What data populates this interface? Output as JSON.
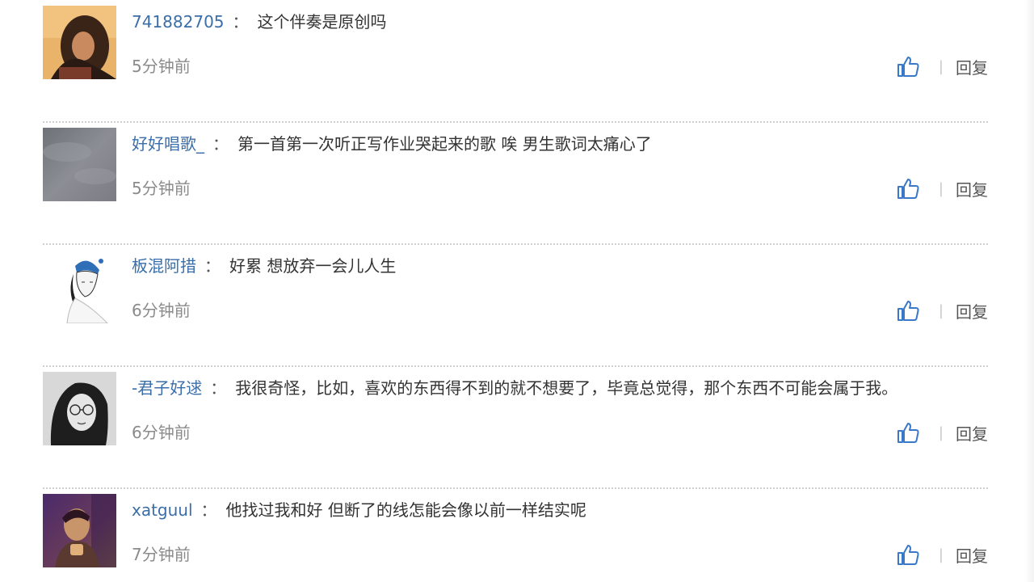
{
  "comments": [
    {
      "username": "741882705",
      "colon": "：",
      "text": "这个伴奏是原创吗",
      "time": "5分钟前",
      "reply_label": "回复",
      "separator": "|"
    },
    {
      "username": "好好唱歌_",
      "colon": "：",
      "text": "第一首第一次听正写作业哭起来的歌 唉 男生歌词太痛心了",
      "time": "5分钟前",
      "reply_label": "回复",
      "separator": "|"
    },
    {
      "username": "板混阿措",
      "colon": "：",
      "text": "好累 想放弃一会儿人生",
      "time": "6分钟前",
      "reply_label": "回复",
      "separator": "|"
    },
    {
      "username": "-君子好逑",
      "colon": "：",
      "text": "我很奇怪，比如，喜欢的东西得不到的就不想要了，毕竟总觉得，那个东西不可能会属于我。",
      "time": "6分钟前",
      "reply_label": "回复",
      "separator": "|"
    },
    {
      "username": "xatguul",
      "colon": "：",
      "text": "他找过我和好 但断了的线怎能会像以前一样结实呢",
      "time": "7分钟前",
      "reply_label": "回复",
      "separator": "|"
    }
  ],
  "colors": {
    "username": "#3a6ea8",
    "text": "#333333",
    "time": "#8b8b8b",
    "like_icon": "#3a78c8",
    "divider": "#cfcfcf"
  },
  "icons": {
    "like": "thumbs-up-icon"
  }
}
